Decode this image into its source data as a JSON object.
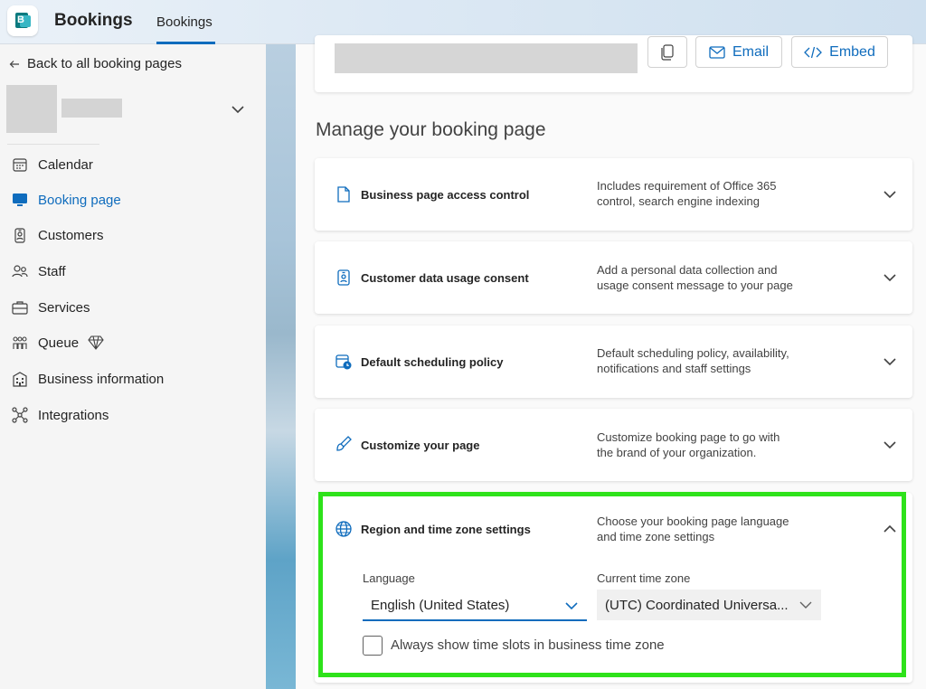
{
  "header": {
    "app_title": "Bookings",
    "tab_label": "Bookings",
    "accent_color": "#0f6cbd",
    "app_icon": "bookings-app-icon"
  },
  "sidebar": {
    "back_label": "Back to all booking pages",
    "items": [
      {
        "label": "Calendar",
        "icon": "calendar-icon",
        "active": false
      },
      {
        "label": "Booking page",
        "icon": "monitor-icon",
        "active": true
      },
      {
        "label": "Customers",
        "icon": "customer-badge-icon",
        "active": false
      },
      {
        "label": "Staff",
        "icon": "people-icon",
        "active": false
      },
      {
        "label": "Services",
        "icon": "briefcase-icon",
        "active": false
      },
      {
        "label": "Queue",
        "icon": "people-queue-icon",
        "active": false,
        "badge_icon": "diamond-premium-icon"
      },
      {
        "label": "Business information",
        "icon": "building-icon",
        "active": false
      },
      {
        "label": "Integrations",
        "icon": "integrations-icon",
        "active": false
      }
    ]
  },
  "share": {
    "email_label": "Email",
    "embed_label": "Embed"
  },
  "main": {
    "section_title": "Manage your booking page",
    "sections": [
      {
        "title": "Business page access control",
        "desc_line1": "Includes requirement of Office 365",
        "desc_line2": "control, search engine indexing",
        "icon": "document-icon"
      },
      {
        "title": "Customer data usage consent",
        "desc_line1": "Add a personal data collection and",
        "desc_line2": "usage consent message to your page",
        "icon": "badge-person-icon"
      },
      {
        "title": "Default scheduling policy",
        "desc_line1": "Default scheduling policy, availability,",
        "desc_line2": "notifications and staff settings",
        "icon": "calendar-clock-icon"
      },
      {
        "title": "Customize your page",
        "desc_line1": "Customize booking page to go with",
        "desc_line2": "the brand of your organization.",
        "icon": "paint-brush-icon"
      }
    ],
    "region": {
      "title": "Region and time zone settings",
      "desc_line1": "Choose your booking page language",
      "desc_line2": "and time zone settings",
      "language_label": "Language",
      "language_value": "English (United States)",
      "timezone_label": "Current time zone",
      "timezone_value": "(UTC) Coordinated Universa...",
      "checkbox_label": "Always show time slots in business time zone",
      "checkbox_checked": false
    }
  },
  "highlight_color": "#2ee21a"
}
